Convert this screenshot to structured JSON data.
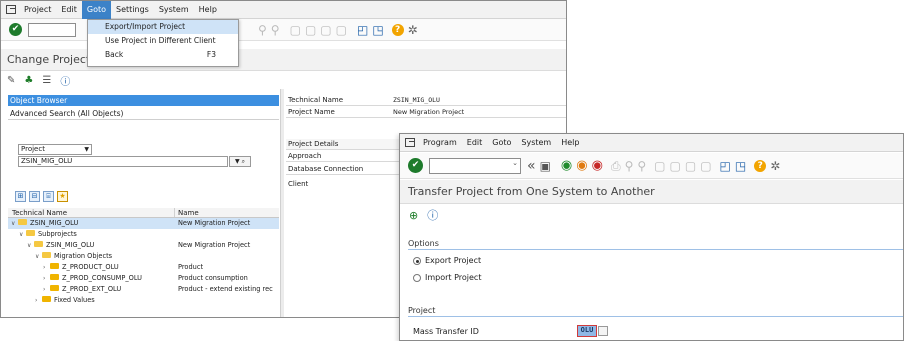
{
  "window1": {
    "menu": [
      "Project",
      "Edit",
      "Goto",
      "Settings",
      "System",
      "Help"
    ],
    "goto_menu": {
      "items": [
        {
          "label": "Export/Import Project",
          "shortcut": ""
        },
        {
          "label": "Use Project in Different Client",
          "shortcut": ""
        },
        {
          "label": "Back",
          "shortcut": "F3"
        }
      ]
    },
    "title": "Change Project",
    "object_browser": "Object Browser",
    "advanced_search": "Advanced Search (All Objects)",
    "project_selector": "Project",
    "project_value": "ZSIN_MIG_OLU",
    "tree": {
      "columns": [
        "Technical Name",
        "Name"
      ],
      "rows": [
        {
          "tech": "ZSIN_MIG_OLU",
          "name": "New Migration Project"
        },
        {
          "tech": "Subprojects",
          "name": ""
        },
        {
          "tech": "ZSIN_MIG_OLU",
          "name": "New Migration Project"
        },
        {
          "tech": "Migration Objects",
          "name": ""
        },
        {
          "tech": "Z_PRODUCT_OLU",
          "name": "Product"
        },
        {
          "tech": "Z_PROD_CONSUMP_OLU",
          "name": "Product consumption"
        },
        {
          "tech": "Z_PROD_EXT_OLU",
          "name": "Product - extend existing rec"
        },
        {
          "tech": "Fixed Values",
          "name": ""
        }
      ]
    },
    "details": {
      "technical_name_label": "Technical Name",
      "technical_name_value": "ZSIN_MIG_OLU",
      "project_name_label": "Project Name",
      "project_name_value": "New Migration Project",
      "project_details": "Project Details",
      "approach": "Approach",
      "database_connection": "Database Connection",
      "client": "Client"
    }
  },
  "window2": {
    "menu": [
      "Program",
      "Edit",
      "Goto",
      "System",
      "Help"
    ],
    "title": "Transfer Project from One System to Another",
    "options_section": "Options",
    "radio_export": "Export Project",
    "radio_import": "Import Project",
    "project_section": "Project",
    "mass_transfer_label": "Mass Transfer ID",
    "mass_transfer_value": "OLU"
  }
}
